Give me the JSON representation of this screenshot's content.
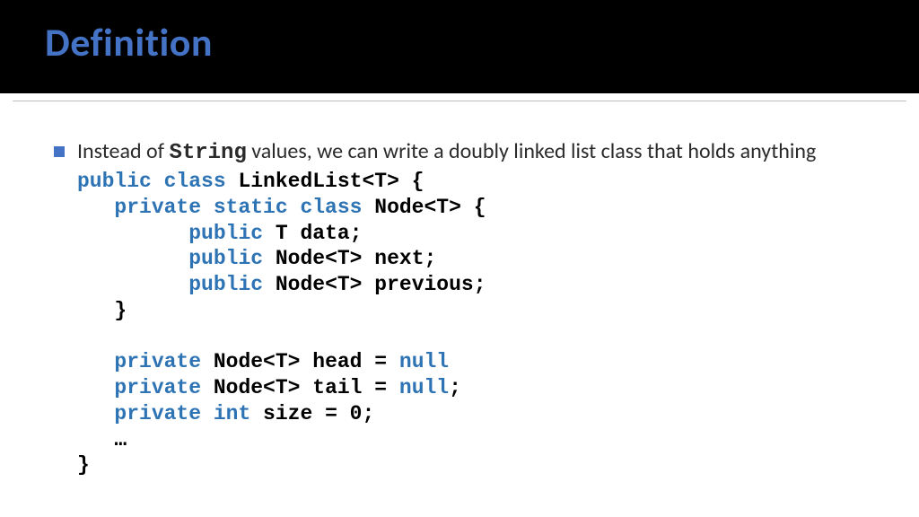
{
  "header": {
    "title": "Definition"
  },
  "content": {
    "bullet_prefix": "Instead of ",
    "bullet_code_word": "String",
    "bullet_suffix": " values, we can write a doubly linked list class that holds anything",
    "code": {
      "l1_kw": "public class",
      "l1_rest": " LinkedList<T> {",
      "l2_pad": "   ",
      "l2_kw": "private static class",
      "l2_rest": " Node<T> {",
      "l3_pad": "         ",
      "l3_kw": "public",
      "l3_rest": " T data;",
      "l4_pad": "         ",
      "l4_kw": "public",
      "l4_rest": " Node<T> next;",
      "l5_pad": "         ",
      "l5_kw": "public",
      "l5_rest": " Node<T> previous;",
      "l6": "   }",
      "l7": "",
      "l8_pad": "   ",
      "l8_kw": "private",
      "l8_mid": " Node<T> head = ",
      "l8_kw2": "null",
      "l9_pad": "   ",
      "l9_kw": "private",
      "l9_mid": " Node<T> tail = ",
      "l9_kw2": "null",
      "l9_end": ";",
      "l10_pad": "   ",
      "l10_kw": "private int",
      "l10_rest": " size = 0;",
      "l11": "   …",
      "l12": "}"
    }
  }
}
